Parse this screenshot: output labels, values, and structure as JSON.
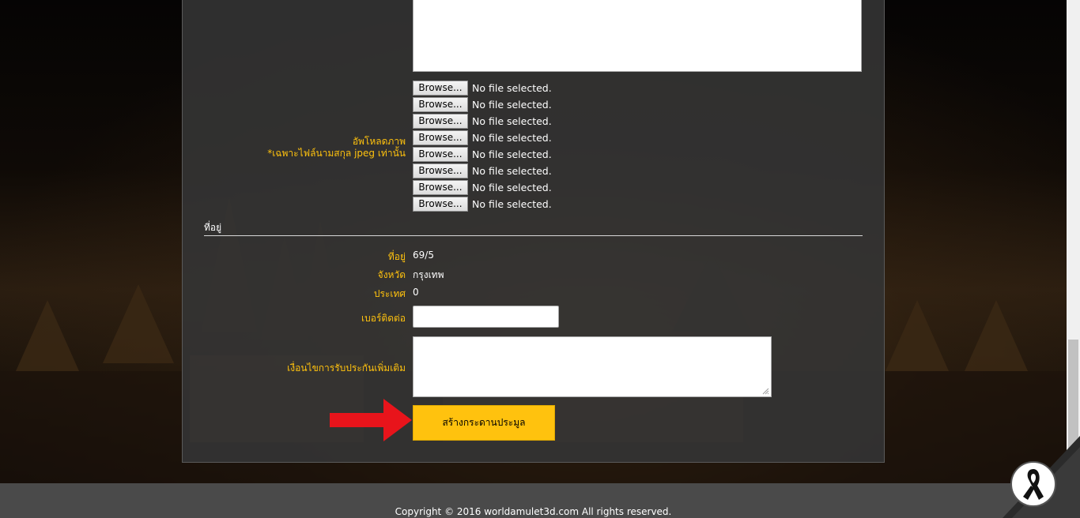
{
  "upload": {
    "label_line1": "อัพโหลดภาพ",
    "label_line2": "*เฉพาะไฟล์นามสกุล jpeg เท่านั้น",
    "files": [
      {
        "button": "Browse...",
        "status": "No file selected."
      },
      {
        "button": "Browse...",
        "status": "No file selected."
      },
      {
        "button": "Browse...",
        "status": "No file selected."
      },
      {
        "button": "Browse...",
        "status": "No file selected."
      },
      {
        "button": "Browse...",
        "status": "No file selected."
      },
      {
        "button": "Browse...",
        "status": "No file selected."
      },
      {
        "button": "Browse...",
        "status": "No file selected."
      },
      {
        "button": "Browse...",
        "status": "No file selected."
      }
    ]
  },
  "address_section": {
    "title": "ที่อยู่",
    "address_label": "ที่อยู่",
    "address_value": "69/5",
    "province_label": "จังหวัด",
    "province_value": "กรุงเทพ",
    "country_label": "ประเทศ",
    "country_value": "0",
    "phone_label": "เบอร์ติดต่อ",
    "phone_value": "",
    "conditions_label": "เงื่อนไขการรับประกันเพิ่มเติม",
    "conditions_value": ""
  },
  "submit": {
    "label": "สร้างกระดานประมูล"
  },
  "footer": {
    "copyright": "Copyright © 2016 worldamulet3d.com All rights reserved."
  },
  "colors": {
    "accent": "#ffc20e",
    "panel": "#343434",
    "footer": "#4a4a4a",
    "arrow": "#e8141b"
  },
  "icons": {
    "arrow": "red-arrow-icon",
    "badge": "black-ribbon-icon",
    "grip": "resize-grip-icon"
  }
}
